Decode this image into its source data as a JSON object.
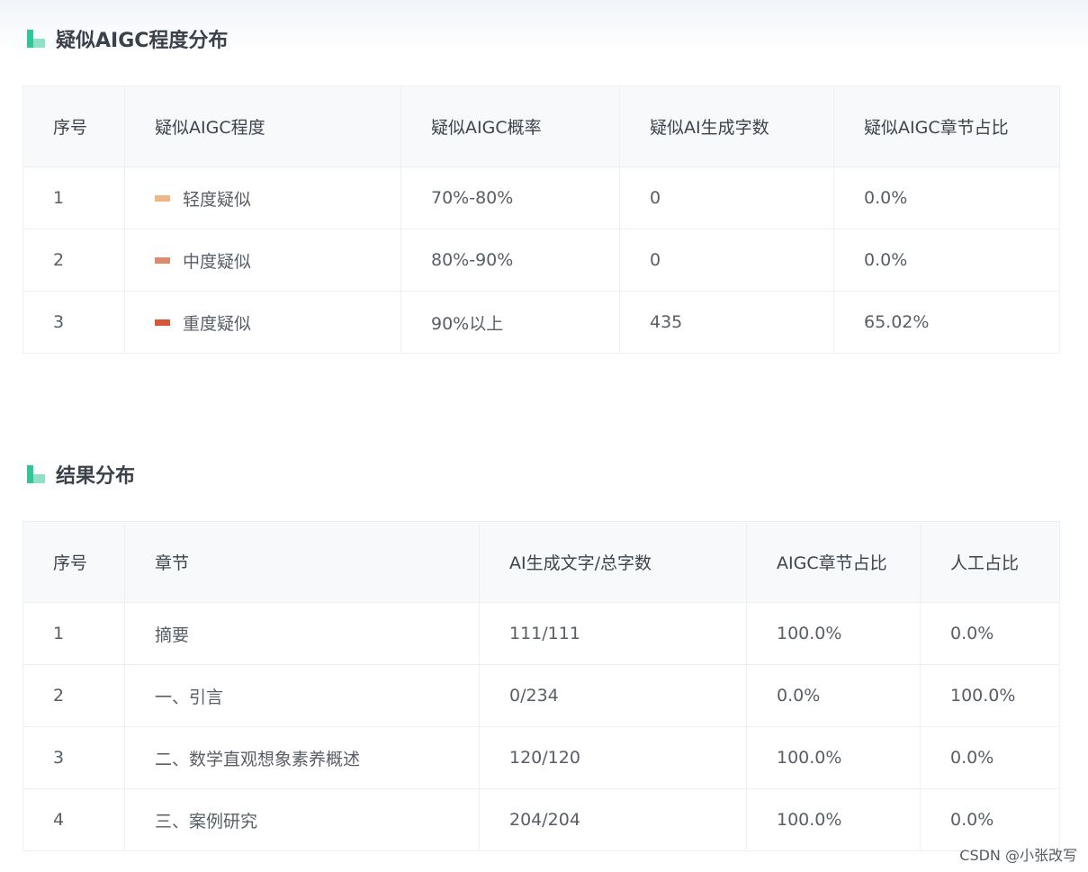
{
  "section1": {
    "title": "疑似AIGC程度分布",
    "headers": [
      "序号",
      "疑似AIGC程度",
      "疑似AIGC概率",
      "疑似AI生成字数",
      "疑似AIGC章节占比"
    ],
    "rows": [
      {
        "index": "1",
        "level": "轻度疑似",
        "level_color": "#f0b684",
        "probability": "70%-80%",
        "chars": "0",
        "ratio": "0.0%"
      },
      {
        "index": "2",
        "level": "中度疑似",
        "level_color": "#e08a6c",
        "probability": "80%-90%",
        "chars": "0",
        "ratio": "0.0%"
      },
      {
        "index": "3",
        "level": "重度疑似",
        "level_color": "#d9563a",
        "probability": "90%以上",
        "chars": "435",
        "ratio": "65.02%"
      }
    ]
  },
  "section2": {
    "title": "结果分布",
    "headers": [
      "序号",
      "章节",
      "AI生成文字/总字数",
      "AIGC章节占比",
      "人工占比"
    ],
    "rows": [
      {
        "index": "1",
        "chapter": "摘要",
        "ai_total": "111/111",
        "aigc_ratio": "100.0%",
        "human_ratio": "0.0%"
      },
      {
        "index": "2",
        "chapter": "一、引言",
        "ai_total": "0/234",
        "aigc_ratio": "0.0%",
        "human_ratio": "100.0%"
      },
      {
        "index": "3",
        "chapter": "二、数学直观想象素养概述",
        "ai_total": "120/120",
        "aigc_ratio": "100.0%",
        "human_ratio": "0.0%"
      },
      {
        "index": "4",
        "chapter": "三、案例研究",
        "ai_total": "204/204",
        "aigc_ratio": "100.0%",
        "human_ratio": "0.0%"
      }
    ]
  },
  "colors": {
    "accent_green": "#2fc79a",
    "ratio_red": "#c9603f"
  },
  "icons": [
    "chart-bar-icon"
  ],
  "watermark": "CSDN @小张改写"
}
